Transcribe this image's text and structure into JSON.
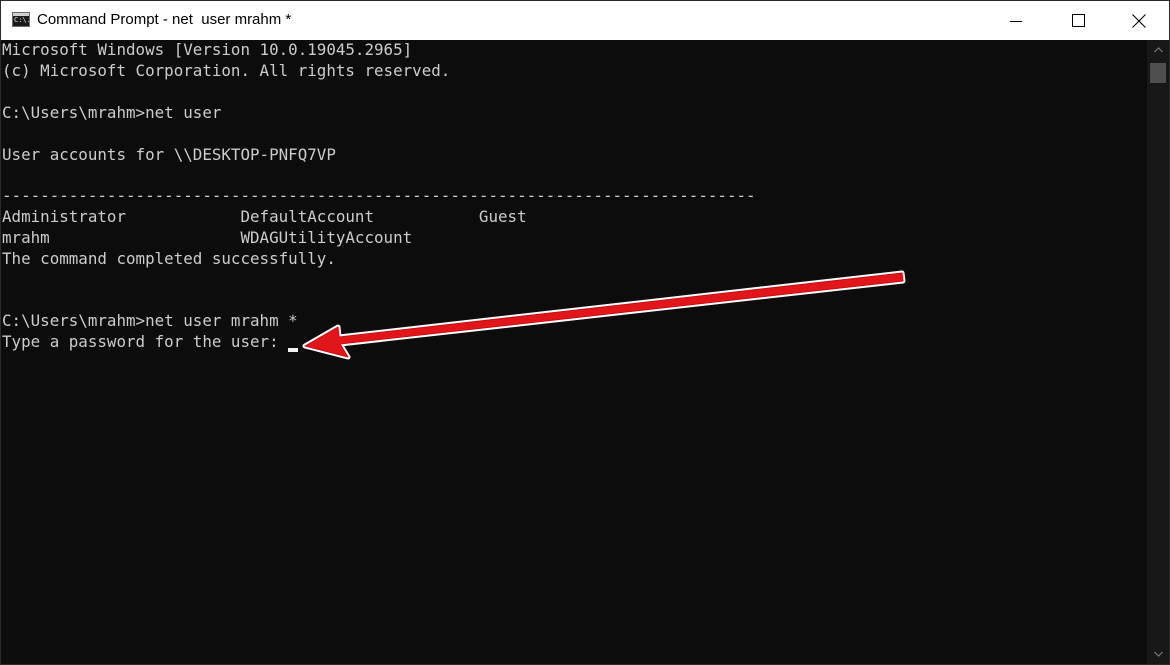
{
  "window": {
    "title": "Command Prompt - net  user mrahm *",
    "icon": "cmd-icon",
    "icon_text": "C:\\."
  },
  "controls": {
    "minimize": "minimize-icon",
    "maximize": "maximize-icon",
    "close": "close-icon"
  },
  "terminal": {
    "lines": [
      "Microsoft Windows [Version 10.0.19045.2965]",
      "(c) Microsoft Corporation. All rights reserved.",
      "",
      "C:\\Users\\mrahm>net user",
      "",
      "User accounts for \\\\DESKTOP-PNFQ7VP",
      "",
      "-------------------------------------------------------------------------------",
      "Administrator            DefaultAccount           Guest",
      "mrahm                    WDAGUtilityAccount",
      "The command completed successfully.",
      "",
      "",
      "C:\\Users\\mrahm>net user mrahm *",
      "Type a password for the user: "
    ]
  },
  "annotation": {
    "arrow_color": "#e0161b",
    "outline_color": "#ffffff"
  },
  "colors": {
    "terminal_bg": "#0c0c0c",
    "terminal_text": "#cccccc",
    "titlebar_bg": "#ffffff"
  }
}
